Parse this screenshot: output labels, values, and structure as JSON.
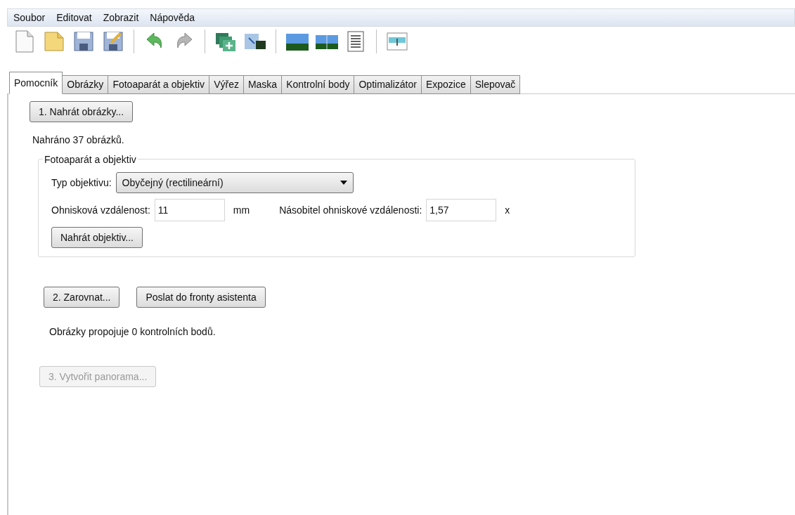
{
  "menu": [
    "Soubor",
    "Editovat",
    "Zobrazit",
    "Nápověda"
  ],
  "tabs": [
    {
      "label": "Pomocník",
      "selected": true
    },
    {
      "label": "Obrázky",
      "selected": false
    },
    {
      "label": "Fotoaparát a objektiv",
      "selected": false
    },
    {
      "label": "Výřez",
      "selected": false
    },
    {
      "label": "Maska",
      "selected": false
    },
    {
      "label": "Kontrolní body",
      "selected": false
    },
    {
      "label": "Optimalizátor",
      "selected": false
    },
    {
      "label": "Expozice",
      "selected": false
    },
    {
      "label": "Slepovač",
      "selected": false
    }
  ],
  "load_button": {
    "label": "1. Nahrát obrázky...",
    "disabled": false
  },
  "loaded_status": "Nahráno 37 obrázků.",
  "camera_group": {
    "title": "Fotoaparát a objektiv",
    "lens_type_label": "Typ objektivu:",
    "lens_type": "Obyčejný (rectilineární)",
    "focal_label": "Ohnisková vzdálenost:",
    "focal_value": "11",
    "focal_unit": "mm",
    "crop_label": "Násobitel ohniskové vzdálenosti:",
    "crop_value": "1,57",
    "crop_unit": "x",
    "load_lens_button": {
      "label": "Nahrát objektiv...",
      "disabled": false
    }
  },
  "align_button": {
    "label": "2. Zarovnat...",
    "disabled": false
  },
  "queue_button": {
    "label": "Poslat do fronty asistenta",
    "disabled": false
  },
  "points_status": "Obrázky propojuje 0 kontrolních bodů.",
  "create_button": {
    "label": "3. Vytvořit panorama...",
    "disabled": true
  }
}
